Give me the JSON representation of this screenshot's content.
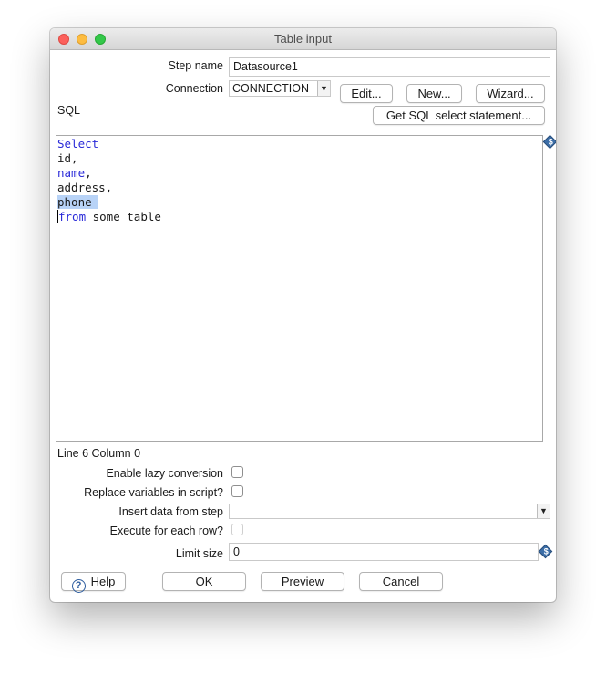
{
  "window": {
    "title": "Table input"
  },
  "form": {
    "step_name_label": "Step name",
    "step_name_value": "Datasource1",
    "connection_label": "Connection",
    "connection_value": "CONNECTION",
    "edit_button": "Edit...",
    "new_button": "New...",
    "wizard_button": "Wizard...",
    "sql_label": "SQL",
    "get_sql_button": "Get SQL select statement..."
  },
  "editor": {
    "lines": [
      {
        "text": "Select",
        "keyword": true
      },
      {
        "text": "id,",
        "keyword": false
      },
      {
        "text": "name",
        "suffix": ",",
        "keyword": true
      },
      {
        "text": "address,",
        "keyword": false
      },
      {
        "text": "phone",
        "keyword": false,
        "selected": true
      },
      {
        "text": "from",
        "suffix": " some_table",
        "keyword": true
      }
    ],
    "status": "Line 6 Column 0"
  },
  "options": {
    "lazy_label": "Enable lazy conversion",
    "lazy_checked": false,
    "replace_label": "Replace variables in script?",
    "replace_checked": false,
    "insert_label": "Insert data from step",
    "insert_value": "",
    "execute_label": "Execute for each row?",
    "execute_checked": false,
    "limit_label": "Limit size",
    "limit_value": "0"
  },
  "footer": {
    "help_button": "Help",
    "ok_button": "OK",
    "preview_button": "Preview",
    "cancel_button": "Cancel"
  },
  "colors": {
    "keyword": "#2a2ad8",
    "selection": "#b8d3f7",
    "close": "#fc605b",
    "minimize": "#fdbc40",
    "maximize": "#34c84a"
  }
}
